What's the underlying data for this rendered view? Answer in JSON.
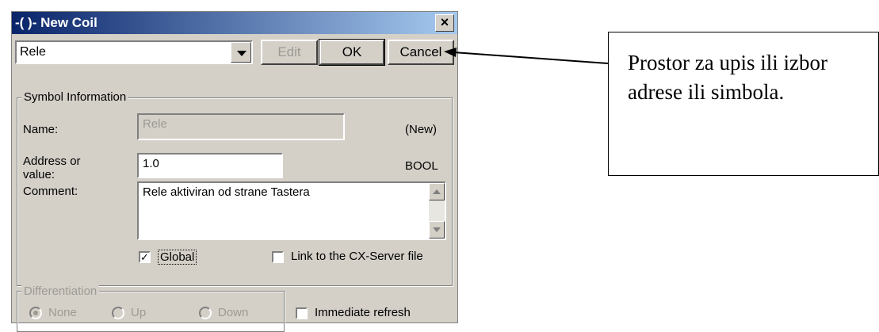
{
  "window": {
    "title": "-( )- New Coil"
  },
  "toolbar": {
    "combo_value": "Rele",
    "edit_label": "Edit",
    "ok_label": "OK",
    "cancel_label": "Cancel"
  },
  "symbol_info": {
    "group_label": "Symbol Information",
    "name_label": "Name:",
    "name_value": "Rele",
    "name_status": "(New)",
    "address_label_line1": "Address or",
    "address_label_line2": "value:",
    "address_value": "1.0",
    "address_type": "BOOL",
    "comment_label": "Comment:",
    "comment_value": "Rele aktiviran od strane Tastera",
    "global_label": "Global",
    "global_checked": true,
    "link_label": "Link to the CX-Server file",
    "link_checked": false
  },
  "differentiation": {
    "group_label": "Differentiation",
    "options": [
      "None",
      "Up",
      "Down"
    ],
    "selected": "None"
  },
  "immediate_refresh": {
    "label": "Immediate refresh",
    "checked": false
  },
  "annotation": {
    "text": "Prostor za upis ili izbor adrese ili simbola."
  }
}
